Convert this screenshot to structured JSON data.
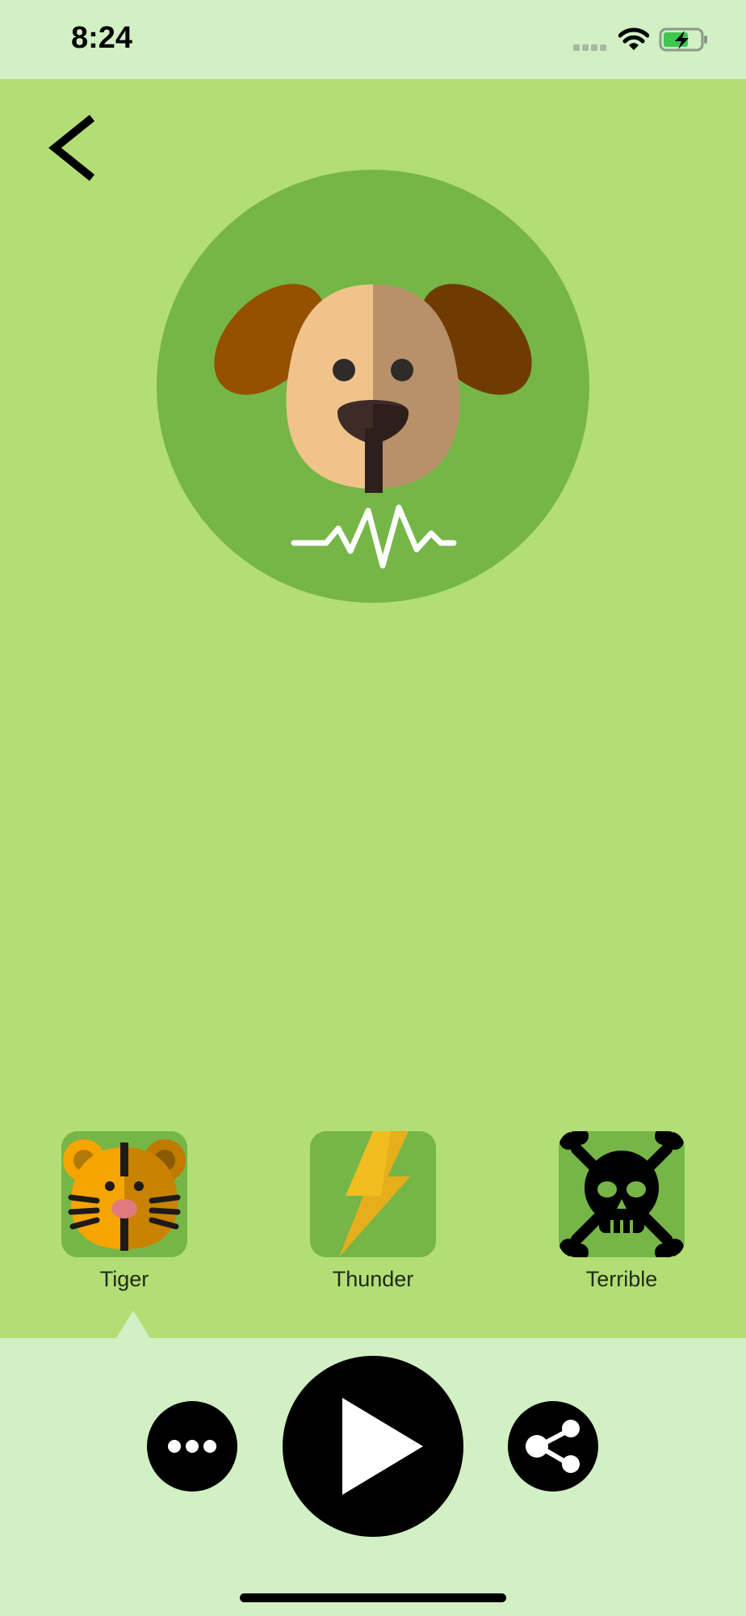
{
  "status_bar": {
    "time": "8:24",
    "icons": [
      "signal-icon",
      "wifi-icon",
      "battery-charging-icon"
    ]
  },
  "nav": {
    "back_icon": "chevron-left-icon"
  },
  "hero": {
    "icon": "dog-face-icon",
    "waveform_icon": "sound-wave-icon"
  },
  "sounds": [
    {
      "label": "Tiger",
      "icon": "tiger-face-icon"
    },
    {
      "label": "Thunder",
      "icon": "lightning-bolt-icon"
    },
    {
      "label": "Terrible",
      "icon": "skull-crossbones-icon"
    }
  ],
  "controls": {
    "more_icon": "more-icon",
    "play_icon": "play-icon",
    "share_icon": "share-icon"
  },
  "colors": {
    "status_bg": "#d1f0c4",
    "main_bg": "#b3de75",
    "circle_green": "#76b647",
    "control_bg": "#000000"
  }
}
